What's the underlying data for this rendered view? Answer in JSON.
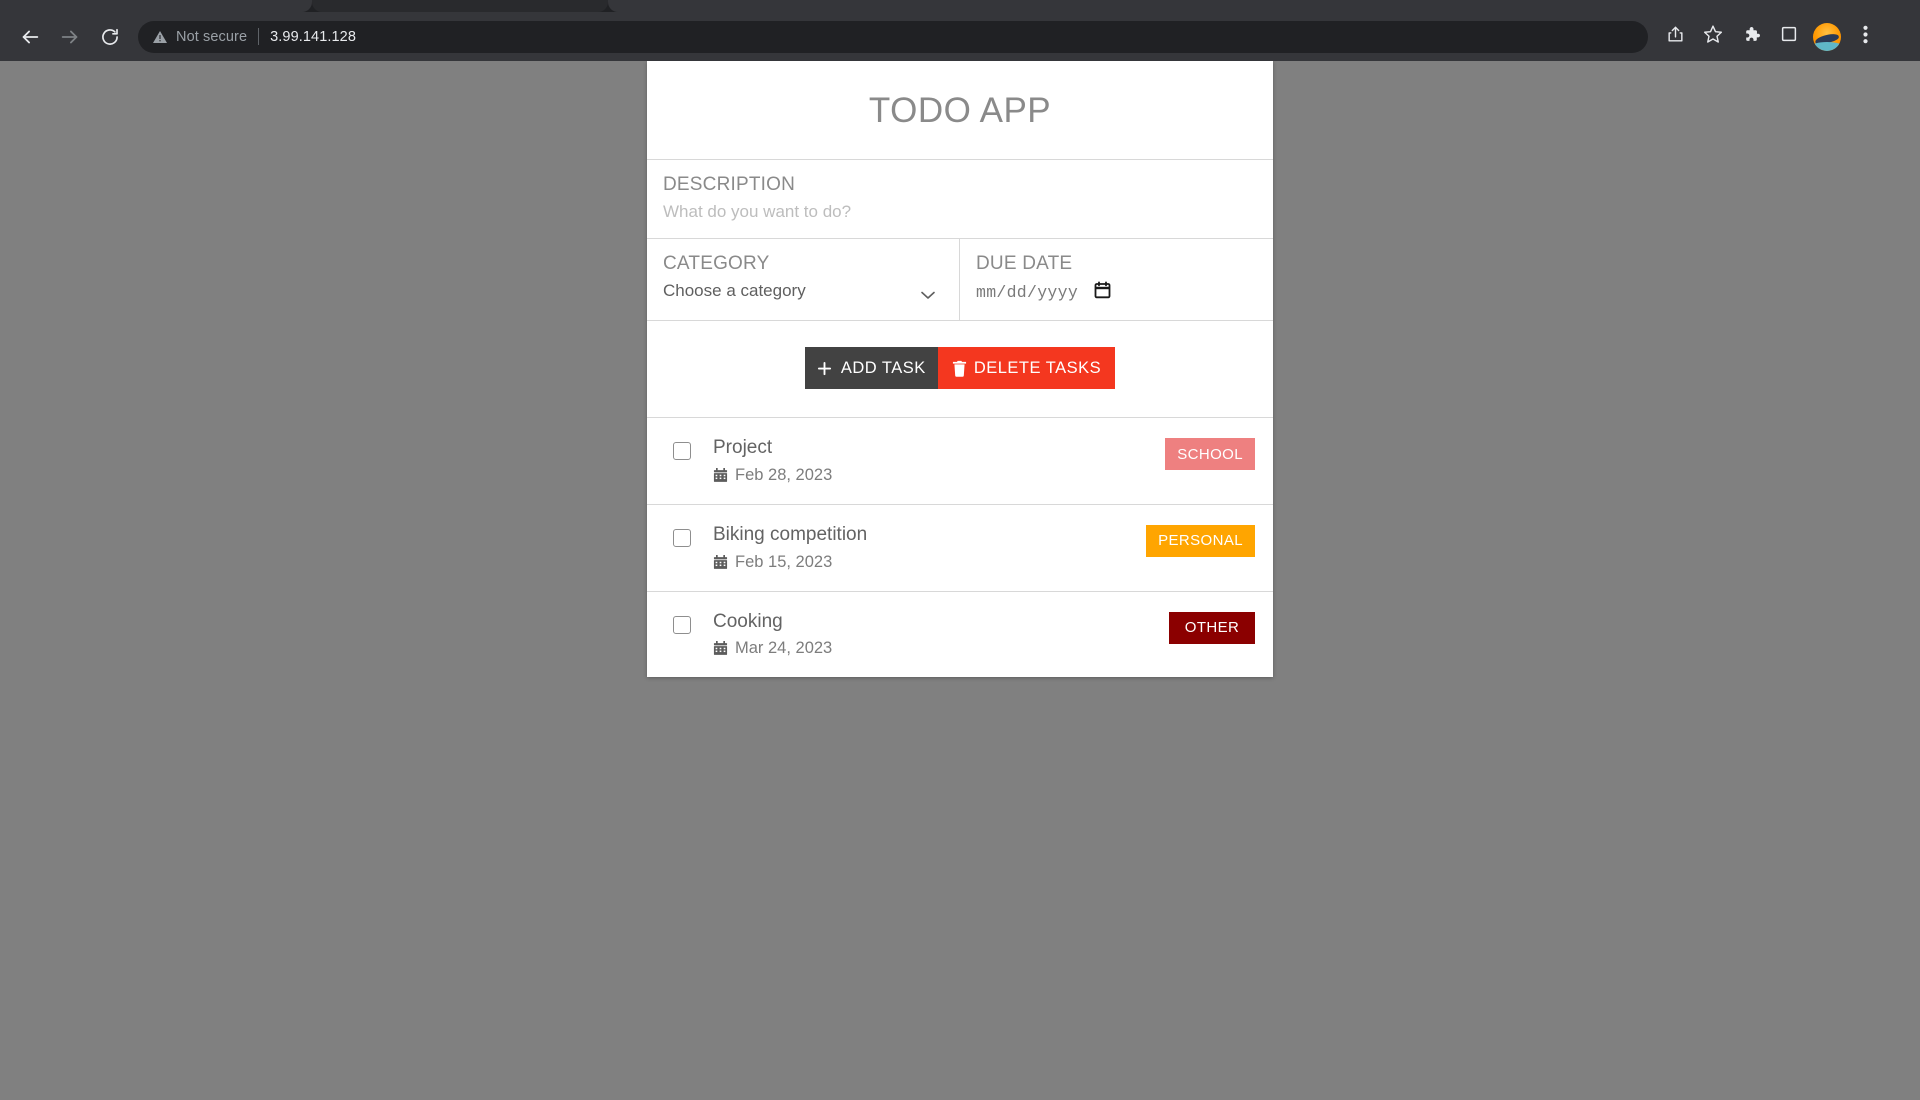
{
  "browser": {
    "back_icon": "back-arrow-icon",
    "forward_icon": "forward-arrow-icon",
    "reload_icon": "reload-icon",
    "security_label": "Not secure",
    "security_icon": "warning-triangle-icon",
    "url": "3.99.141.128",
    "toolbar_icons": [
      {
        "name": "share-icon",
        "label": "Share"
      },
      {
        "name": "bookmark-star-icon",
        "label": "Bookmark this tab"
      },
      {
        "name": "extensions-puzzle-icon",
        "label": "Extensions"
      },
      {
        "name": "side-panel-icon",
        "label": "Side panel"
      },
      {
        "name": "profile-avatar-icon",
        "label": "Profile"
      },
      {
        "name": "three-dot-menu-icon",
        "label": "Customize and control"
      }
    ]
  },
  "app": {
    "title": "TODO APP",
    "description": {
      "label": "DESCRIPTION",
      "placeholder": "What do you want to do?",
      "value": ""
    },
    "category": {
      "label": "CATEGORY",
      "selected": "Choose a category",
      "options": [
        "Choose a category",
        "SCHOOL",
        "PERSONAL",
        "OTHER"
      ]
    },
    "due_date": {
      "label": "DUE DATE",
      "placeholder": "mm/dd/yyyy",
      "value": ""
    },
    "actions": {
      "add_label": "ADD TASK",
      "add_icon": "plus-icon",
      "add_color": "#424242",
      "delete_label": "DELETE TASKS",
      "delete_icon": "trash-icon",
      "delete_color": "#f4371f"
    },
    "tasks": [
      {
        "name": "Project",
        "date": "Feb 28, 2023",
        "date_icon": "calendar-icon",
        "category": "SCHOOL",
        "category_color": "#ee8080",
        "checked": false
      },
      {
        "name": "Biking competition",
        "date": "Feb 15, 2023",
        "date_icon": "calendar-icon",
        "category": "PERSONAL",
        "category_color": "#ffa500",
        "checked": false
      },
      {
        "name": "Cooking",
        "date": "Mar 24, 2023",
        "date_icon": "calendar-icon",
        "category": "OTHER",
        "category_color": "#8b0000",
        "checked": false
      }
    ]
  },
  "theme": {
    "page_background": "#808080",
    "card_background": "#ffffff",
    "title_color": "#8a8a8a",
    "border_color": "#d8d8d8"
  }
}
